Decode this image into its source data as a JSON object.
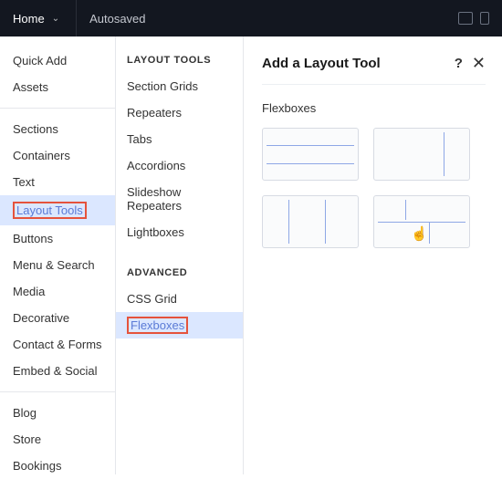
{
  "topbar": {
    "home": "Home",
    "autosaved": "Autosaved"
  },
  "col1": {
    "g1": [
      "Quick Add",
      "Assets"
    ],
    "g2": [
      "Sections",
      "Containers",
      "Text",
      "Layout Tools",
      "Buttons",
      "Menu & Search",
      "Media",
      "Decorative",
      "Contact & Forms",
      "Embed & Social"
    ],
    "g3": [
      "Blog",
      "Store",
      "Bookings"
    ],
    "selected": "Layout Tools"
  },
  "col2": {
    "h1": "LAYOUT TOOLS",
    "a": [
      "Section Grids",
      "Repeaters",
      "Tabs",
      "Accordions",
      "Slideshow Repeaters",
      "Lightboxes"
    ],
    "h2": "ADVANCED",
    "b": [
      "CSS Grid",
      "Flexboxes"
    ],
    "selected": "Flexboxes"
  },
  "panel": {
    "title": "Add a Layout Tool",
    "help": "?",
    "close": "X",
    "sub": "Flexboxes"
  }
}
